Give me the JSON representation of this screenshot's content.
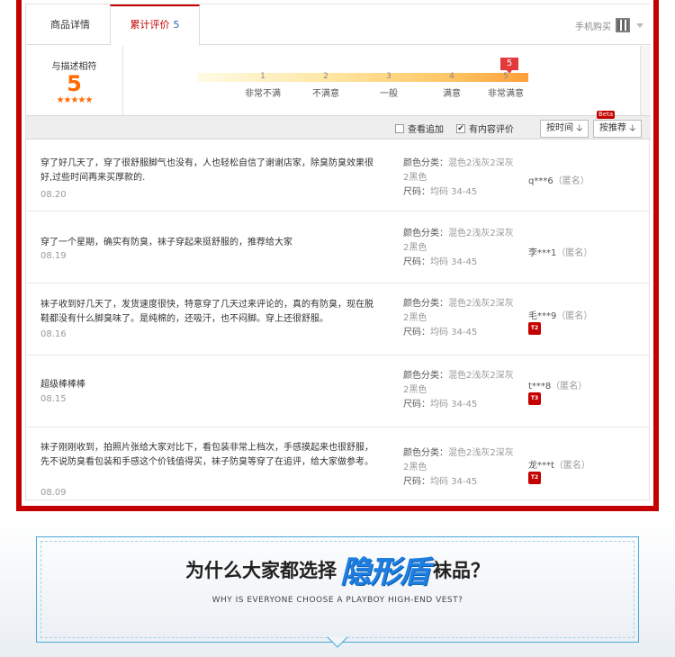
{
  "tabs": {
    "details_label": "商品详情",
    "reviews_label": "累计评价",
    "reviews_count": "5",
    "mobile_buy": "手机购买"
  },
  "summary": {
    "label": "与描述相符",
    "score": "5",
    "stars": "★★★★★",
    "flag_value": "5",
    "ticks": [
      "1",
      "2",
      "3",
      "4",
      "5"
    ],
    "tick_labels": [
      "非常不满",
      "不满意",
      "一般",
      "满意",
      "非常满意"
    ]
  },
  "filters": {
    "append_label": "查看追加",
    "append_checked": false,
    "content_label": "有内容评价",
    "content_checked": true,
    "sort_time": "按时间",
    "sort_recommend": "按推荐",
    "beta": "Beta"
  },
  "reviews": [
    {
      "text": "穿了好几天了，穿了很舒服脚气也没有，人也轻松自信了谢谢店家，除臭防臭效果很好,过些时间再来买厚款的.",
      "date": "08.20",
      "color_label": "颜色分类：",
      "color_value": "混色2浅灰2深灰2黑色",
      "size_label": "尺码：",
      "size_value": "均码 34-45",
      "user": "q***6",
      "anon": "（匿名）",
      "level": ""
    },
    {
      "text": "穿了一个星期，确实有防臭，袜子穿起来挺舒服的，推荐给大家",
      "date": "08.19",
      "color_label": "颜色分类：",
      "color_value": "混色2浅灰2深灰2黑色",
      "size_label": "尺码：",
      "size_value": "均码 34-45",
      "user": "李***1",
      "anon": "（匿名）",
      "level": ""
    },
    {
      "text": "袜子收到好几天了，发货速度很快，特意穿了几天过来评论的，真的有防臭，现在脱鞋都没有什么脚臭味了。是纯棉的，还吸汗，也不闷脚。穿上还很舒服。",
      "date": "08.16",
      "color_label": "颜色分类：",
      "color_value": "混色2浅灰2深灰2黑色",
      "size_label": "尺码：",
      "size_value": "均码 34-45",
      "user": "毛***9",
      "anon": "（匿名）",
      "level": "T2"
    },
    {
      "text": "超级棒棒棒",
      "date": "08.15",
      "color_label": "颜色分类：",
      "color_value": "混色2浅灰2深灰2黑色",
      "size_label": "尺码：",
      "size_value": "均码 34-45",
      "user": "t***8",
      "anon": "（匿名）",
      "level": "T3"
    },
    {
      "text": "袜子刚刚收到，拍照片张给大家对比下，看包装非常上档次，手感摸起来也很舒服，先不说防臭看包装和手感这个价钱值得买，袜子防臭等穿了在追评，给大家做参考。",
      "date": "08.09",
      "color_label": "颜色分类：",
      "color_value": "混色2浅灰2深灰2黑色",
      "size_label": "尺码：",
      "size_value": "均码 34-45",
      "user": "龙***t",
      "anon": "（匿名）",
      "level": "T2"
    }
  ],
  "banner": {
    "title_before": "为什么大家都选择",
    "brand": "隐形盾",
    "title_after": "袜品？",
    "subtitle": "WHY IS EVERYONE CHOOSE A PLAYBOY HIGH-END VEST?"
  },
  "colors": {
    "frame_red": "#c40000",
    "score_orange": "#ff6a00",
    "brand_blue": "#1f7fe0"
  }
}
